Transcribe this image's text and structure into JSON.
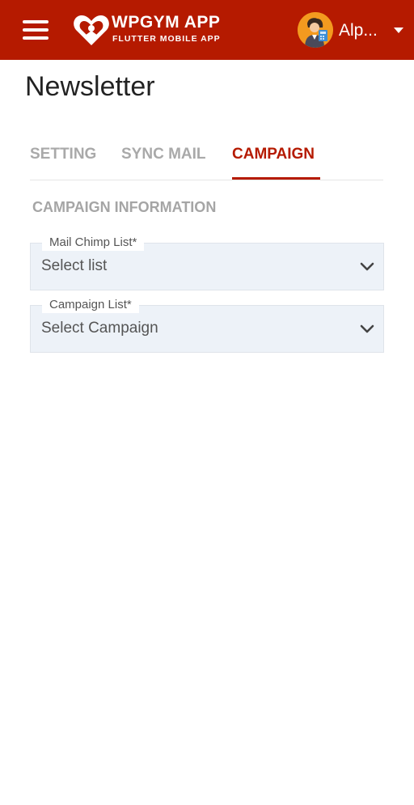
{
  "header": {
    "app_title": "WPGYM APP",
    "app_subtitle": "FLUTTER MOBILE APP",
    "user_name": "Alp...",
    "accent_color": "#b51a00"
  },
  "page": {
    "title": "Newsletter"
  },
  "tabs": [
    {
      "label": "SETTING",
      "active": false
    },
    {
      "label": "SYNC MAIL",
      "active": false
    },
    {
      "label": "CAMPAIGN",
      "active": true
    }
  ],
  "section": {
    "title": "CAMPAIGN INFORMATION"
  },
  "fields": [
    {
      "label": "Mail Chimp List*",
      "value": "Select list",
      "icon": "chevron-down-icon"
    },
    {
      "label": "Campaign List*",
      "value": "Select Campaign",
      "icon": "chevron-down-icon"
    }
  ]
}
